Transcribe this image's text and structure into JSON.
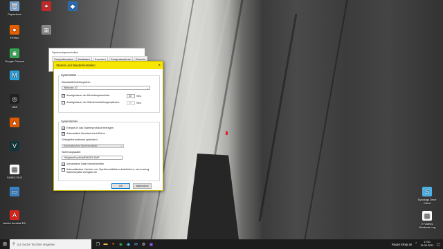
{
  "desktop": {
    "icons": [
      {
        "name": "recycle-bin-icon",
        "label": "Papierkorb",
        "glyph": "🗑",
        "color": "#7aa7d6"
      },
      {
        "name": "firefox-icon",
        "label": "Firefox",
        "glyph": "●",
        "color": "#e66000"
      },
      {
        "name": "chrome-icon",
        "label": "Google Chrome",
        "glyph": "◉",
        "color": "#34a853"
      },
      {
        "name": "app-m-icon",
        "label": "",
        "glyph": "M",
        "color": "#2aa0d8"
      },
      {
        "name": "obs-icon",
        "label": "OBS",
        "glyph": "◎",
        "color": "#222222"
      },
      {
        "name": "app-orange-icon",
        "label": "",
        "glyph": "▲",
        "color": "#e05a00"
      },
      {
        "name": "app-v-icon",
        "label": "",
        "glyph": "V",
        "color": "#12343a"
      },
      {
        "name": "document-icon",
        "label": "SUNDI FILE",
        "glyph": "▤",
        "color": "#ffffff"
      },
      {
        "name": "app-window-icon",
        "label": "",
        "glyph": "▭",
        "color": "#3b82c4"
      },
      {
        "name": "acrobat-icon",
        "label": "Adobe Acrobat DC",
        "glyph": "A",
        "color": "#d9261c"
      },
      {
        "name": "app-star-icon",
        "label": "",
        "glyph": "✶",
        "color": "#c62828"
      },
      {
        "name": "app-gray-icon",
        "label": "",
        "glyph": "▦",
        "color": "#8a8a8a"
      },
      {
        "name": "capture-icon",
        "label": "",
        "glyph": "◆",
        "color": "#2b6cb0"
      }
    ],
    "right_icons": [
      {
        "name": "synology-drive-icon",
        "label": "Synology Drive Client",
        "glyph": "S",
        "color": "#4fb3e8"
      },
      {
        "name": "text-file-icon",
        "label": "IT Videos Windows Log",
        "glyph": "▤",
        "color": "#ffffff"
      }
    ]
  },
  "back_window": {
    "title": "Systemeigenschaften",
    "tabs": [
      "Computername",
      "Hardware",
      "Erweitert",
      "Computerschutz",
      "Remote"
    ],
    "active_tab": 2
  },
  "dialog": {
    "title": "Starten und Wiederherstellen",
    "close_glyph": "×",
    "systemstart": {
      "group_label": "Systemstart",
      "default_os_label": "Standardbetriebssystem:",
      "default_os_value": "Windows 10",
      "show_os_list_label": "Anzeigedauer der Betriebssystemliste:",
      "show_os_list_checked": true,
      "show_os_list_seconds": "30",
      "show_recovery_label": "Anzeigedauer der Wiederherstellungsoptionen:",
      "show_recovery_checked": false,
      "show_recovery_seconds": "30",
      "sec_label": "Sek."
    },
    "systemfehler": {
      "group_label": "Systemfehler",
      "write_event_label": "Ereignis in das Systemprotokoll eintragen",
      "write_event_checked": true,
      "auto_restart_label": "Automatisch Neustart durchführen",
      "auto_restart_checked": true,
      "debug_label": "Debuginformationen speichern",
      "debug_value": "Automatisches Speicherabbild",
      "dump_file_label": "Sicherungsdatei:",
      "dump_file_value": "%SystemRoot%\\MEMORY.DMP",
      "overwrite_label": "Vorhandene Datei überschreiben",
      "overwrite_checked": true,
      "disable_auto_delete_label": "Automatisches Löschen von Speicherabbildern deaktivieren, wenn wenig Speicherplatz verfügbar ist",
      "disable_auto_delete_checked": false
    },
    "ok_label": "OK",
    "cancel_label": "Abbrechen"
  },
  "taskbar": {
    "start_glyph": "⊞",
    "search_placeholder": "Zur Suche Text hier eingeben",
    "search_glyph": "⚲",
    "weather": "Regen klingt ab",
    "time": "17:50",
    "date": "15.05.2022",
    "pinned": [
      "task-view-icon",
      "explorer-icon",
      "firefox-icon",
      "chrome-icon",
      "app-icon",
      "mail-icon",
      "settings-icon",
      "app-active-icon"
    ]
  }
}
